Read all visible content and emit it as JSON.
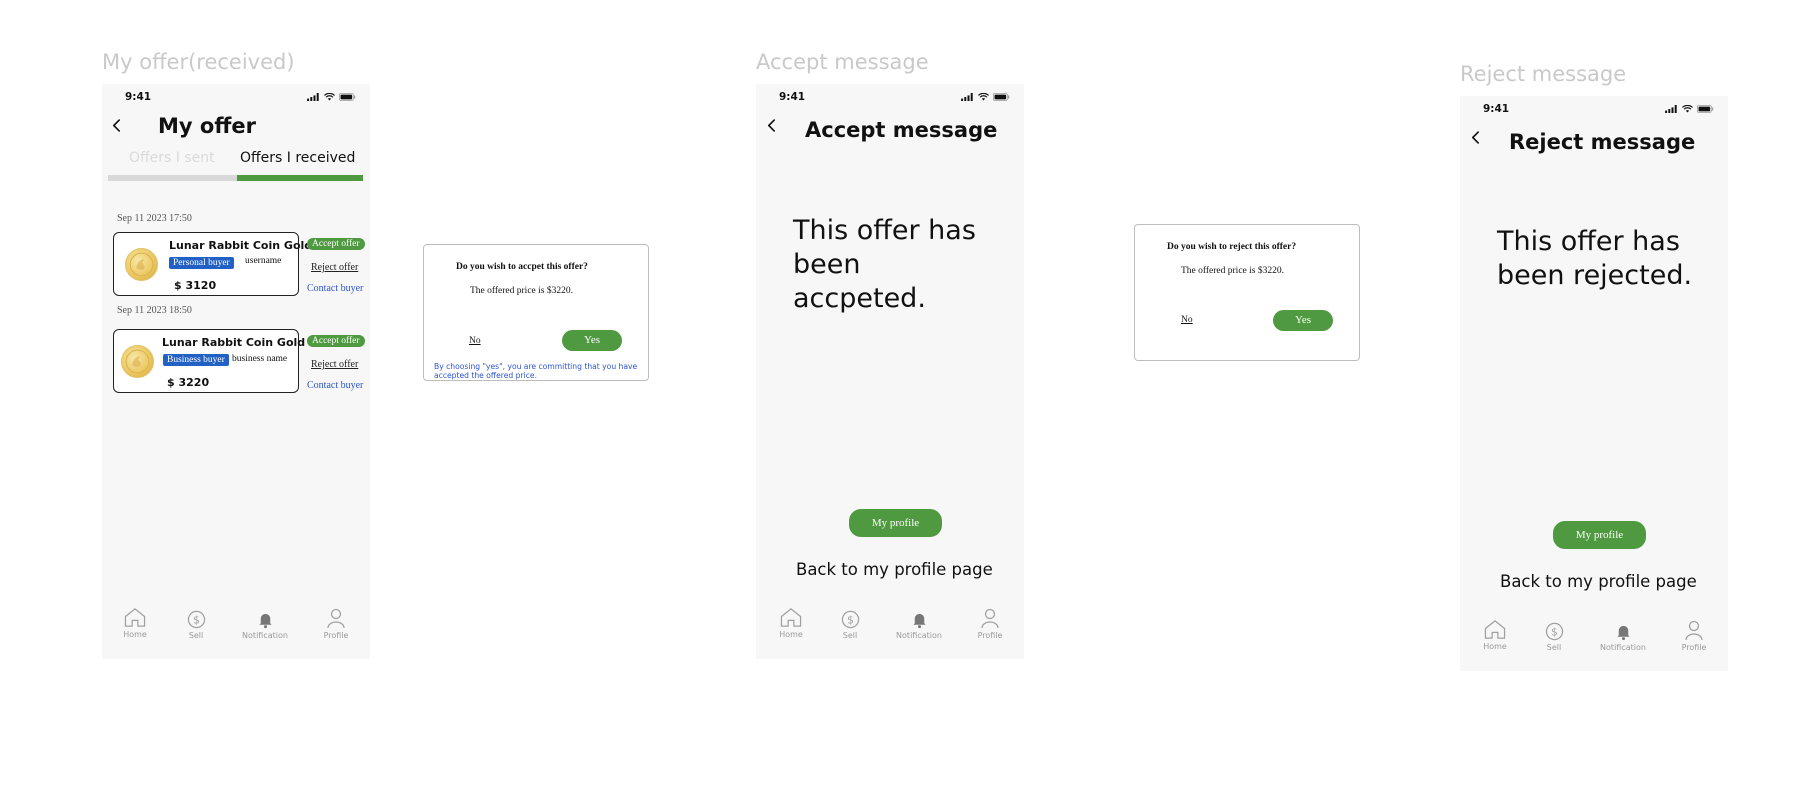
{
  "frames": {
    "offers_label": "My offer(received)",
    "accept_label": "Accept message",
    "reject_label": "Reject message"
  },
  "status_bar": {
    "time": "9:41"
  },
  "offers_screen": {
    "title": "My offer",
    "tabs": [
      "Offers I sent",
      "Offers I received"
    ],
    "active_tab": 1,
    "offers": [
      {
        "date": "Sep 11 2023  17:50",
        "item": "Lunar Rabbit Coin Gold",
        "buyer_type": "Personal buyer",
        "buyer_name": "username",
        "price": "$ 3120",
        "accept_label": "Accept offer",
        "reject_label": "Reject offer",
        "contact_label": "Contact buyer"
      },
      {
        "date": "Sep 11 2023  18:50",
        "item": "Lunar Rabbit Coin Gold",
        "buyer_type": "Business buyer",
        "buyer_name": "business name",
        "price": "$ 3220",
        "accept_label": "Accept offer",
        "reject_label": "Reject offer",
        "contact_label": "Contact buyer"
      }
    ]
  },
  "accept_dialog": {
    "question": "Do you wish to accpet this offer?",
    "price_text": "The offered price is $3220.",
    "no_label": "No",
    "yes_label": "Yes",
    "note": "By choosing \"yes\", you are committing that you have accepted the offered price."
  },
  "accept_screen": {
    "title": "Accept message",
    "message_lines": [
      "This offer has",
      "been",
      "accpeted."
    ],
    "button_label": "My profile",
    "back_link": "Back to my profile page"
  },
  "reject_dialog": {
    "question": "Do you wish to reject this offer?",
    "price_text": "The offered price is $3220.",
    "no_label": "No",
    "yes_label": "Yes"
  },
  "reject_screen": {
    "title": "Reject message",
    "message_lines": [
      "This offer has",
      "been rejected."
    ],
    "button_label": "My profile",
    "back_link": "Back to my profile page"
  },
  "bottom_nav": [
    "Home",
    "Sell",
    "Notification",
    "Profile"
  ],
  "colors": {
    "accent_green": "#4f9a40",
    "badge_blue": "#2160c4",
    "link_blue": "#2c55d0",
    "screen_bg": "#f7f7f7",
    "label_gray": "#c9c9c9"
  },
  "icons": {
    "status": [
      "signal-icon",
      "wifi-icon",
      "battery-icon"
    ],
    "nav": [
      "home-icon",
      "dollar-icon",
      "bell-icon",
      "user-icon"
    ],
    "back": "chevron-left-icon",
    "item": "gold-coin-icon"
  }
}
